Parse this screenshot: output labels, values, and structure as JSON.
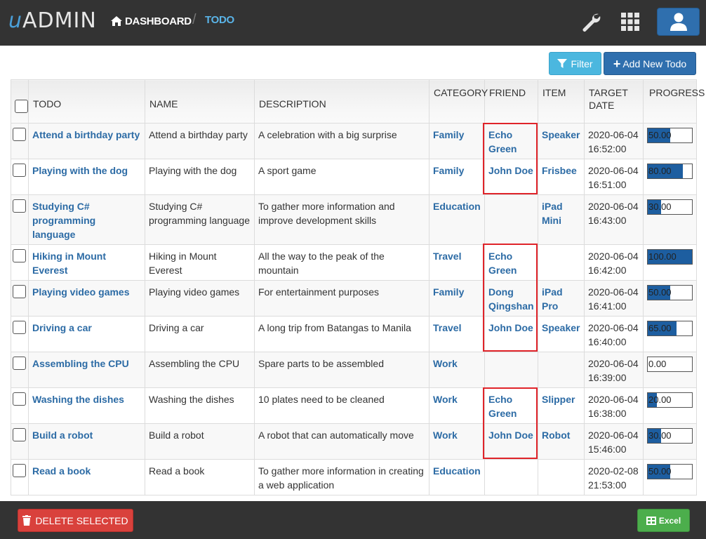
{
  "header": {
    "logo_prefix": "u",
    "logo_text": "ADMIN",
    "breadcrumb_home": "DASHBOARD",
    "breadcrumb_sep": "/",
    "breadcrumb_current": "TODO"
  },
  "toolbar": {
    "filter_label": "Filter",
    "add_label": "Add New Todo"
  },
  "table": {
    "columns": [
      "TODO",
      "NAME",
      "DESCRIPTION",
      "CATEGORY",
      "FRIEND",
      "ITEM",
      "TARGET DATE",
      "PROGRESS"
    ],
    "rows": [
      {
        "todo": "Attend a birthday party",
        "name": "Attend a birthday party",
        "description": "A celebration with a big surprise",
        "category": "Family",
        "friend": "Echo Green",
        "item": "Speaker",
        "target_date": "2020-06-04 16:52:00",
        "progress": "50.00",
        "progress_value": 50
      },
      {
        "todo": "Playing with the dog",
        "name": "Playing with the dog",
        "description": "A sport game",
        "category": "Family",
        "friend": "John Doe",
        "item": "Frisbee",
        "target_date": "2020-06-04 16:51:00",
        "progress": "80.00",
        "progress_value": 80
      },
      {
        "todo": "Studying C# programming language",
        "name": "Studying C# programming language",
        "description": "To gather more information and improve development skills",
        "category": "Education",
        "friend": "",
        "item": "iPad Mini",
        "target_date": "2020-06-04 16:43:00",
        "progress": "30.00",
        "progress_value": 30
      },
      {
        "todo": "Hiking in Mount Everest",
        "name": "Hiking in Mount Everest",
        "description": "All the way to the peak of the mountain",
        "category": "Travel",
        "friend": "Echo Green",
        "item": "",
        "target_date": "2020-06-04 16:42:00",
        "progress": "100.00",
        "progress_value": 100
      },
      {
        "todo": "Playing video games",
        "name": "Playing video games",
        "description": "For entertainment purposes",
        "category": "Family",
        "friend": "Dong Qingshan",
        "item": "iPad Pro",
        "target_date": "2020-06-04 16:41:00",
        "progress": "50.00",
        "progress_value": 50
      },
      {
        "todo": "Driving a car",
        "name": "Driving a car",
        "description": "A long trip from Batangas to Manila",
        "category": "Travel",
        "friend": "John Doe",
        "item": "Speaker",
        "target_date": "2020-06-04 16:40:00",
        "progress": "65.00",
        "progress_value": 65
      },
      {
        "todo": "Assembling the CPU",
        "name": "Assembling the CPU",
        "description": "Spare parts to be assembled",
        "category": "Work",
        "friend": "",
        "item": "",
        "target_date": "2020-06-04 16:39:00",
        "progress": "0.00",
        "progress_value": 0
      },
      {
        "todo": "Washing the dishes",
        "name": "Washing the dishes",
        "description": "10 plates need to be cleaned",
        "category": "Work",
        "friend": "Echo Green",
        "item": "Slipper",
        "target_date": "2020-06-04 16:38:00",
        "progress": "20.00",
        "progress_value": 20
      },
      {
        "todo": "Build a robot",
        "name": "Build a robot",
        "description": "A robot that can automatically move",
        "category": "Work",
        "friend": "John Doe",
        "item": "Robot",
        "target_date": "2020-06-04 15:46:00",
        "progress": "30.00",
        "progress_value": 30
      },
      {
        "todo": "Read a book",
        "name": "Read a book",
        "description": "To gather more information in creating a web application",
        "category": "Education",
        "friend": "",
        "item": "",
        "target_date": "2020-02-08 21:53:00",
        "progress": "50.00",
        "progress_value": 50
      }
    ]
  },
  "footer": {
    "delete_label": "DELETE SELECTED",
    "excel_label": "Excel"
  },
  "colors": {
    "header_bg": "#333333",
    "primary": "#2f6fae",
    "info": "#4bb7df",
    "danger": "#d9413c",
    "success": "#4cae4c",
    "link": "#2c6ba5",
    "highlight": "#e0242a"
  },
  "icons": {
    "home": "home-icon",
    "wrench": "wrench-icon",
    "apps": "grid-icon",
    "user": "user-icon",
    "filter": "filter-icon",
    "add": "plus-icon",
    "delete": "trash-icon",
    "excel": "table-icon"
  }
}
